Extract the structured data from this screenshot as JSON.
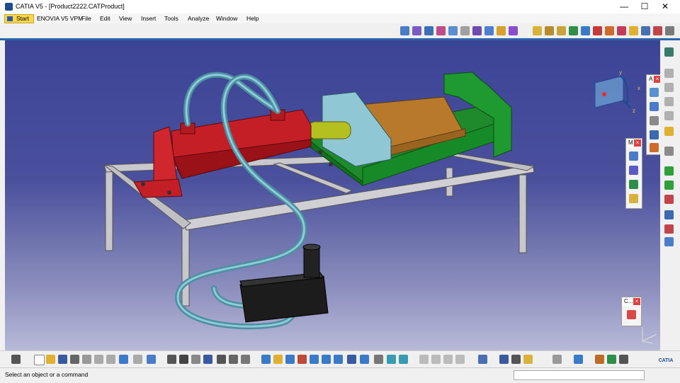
{
  "window": {
    "title": "CATIA V5 - [Product2222.CATProduct]",
    "minimize": "—",
    "maximize": "☐",
    "close": "✕"
  },
  "menu": {
    "items": [
      "Start",
      "ENOVIA V5 VPM",
      "File",
      "Edit",
      "View",
      "Insert",
      "Tools",
      "Analyze",
      "Window",
      "Help"
    ]
  },
  "mdi": {
    "minimize": "−",
    "restore": "▫",
    "close": "×"
  },
  "float_toolbars": {
    "top_right_title": "A",
    "middle_title": "M",
    "bottom_title": "C..."
  },
  "compass": {
    "x_label": "x",
    "y_label": "y",
    "z_label": "z"
  },
  "status": {
    "message": "Select an object or a command",
    "command_value": ""
  },
  "logo": {
    "text": "CATIA"
  },
  "colors": {
    "viewport_top": "#3c4496",
    "viewport_bottom": "#b9bad8",
    "accent": "#2f64a9"
  }
}
